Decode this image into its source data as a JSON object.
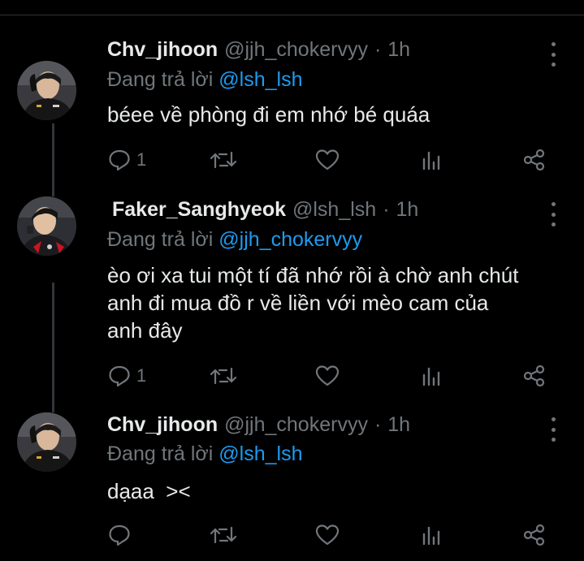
{
  "colors": {
    "background": "#000000",
    "text_primary": "#e7e9ea",
    "text_secondary": "#71767b",
    "mention": "#1d9bf0",
    "thread_line": "#333639"
  },
  "tweets": [
    {
      "display_name": "Chv_jihoon",
      "handle": "@jjh_chokervyy",
      "separator": "·",
      "time": "1h",
      "replying_prefix": "Đang trả lời",
      "replying_to": "@lsh_lsh",
      "text": "béee về phòng đi em nhớ bé quáa",
      "reply_count": "1",
      "avatar_icon": "profile-photo-jihoon"
    },
    {
      "display_name": "Faker_Sanghyeok",
      "handle": "@lsh_lsh",
      "separator": "·",
      "time": "1h",
      "replying_prefix": "Đang trả lời",
      "replying_to": "@jjh_chokervyy",
      "text_lines": [
        "èo ơi xa tui một tí đã nhớ rồi à chờ anh chút",
        "anh đi mua đồ r về liền với mèo cam của",
        "anh đây"
      ],
      "reply_count": "1",
      "avatar_icon": "profile-photo-faker"
    },
    {
      "display_name": "Chv_jihoon",
      "handle": "@jjh_chokervyy",
      "separator": "·",
      "time": "1h",
      "replying_prefix": "Đang trả lời",
      "replying_to": "@lsh_lsh",
      "text": "dạaa  ><",
      "reply_count": "",
      "avatar_icon": "profile-photo-jihoon"
    }
  ],
  "action_icons": [
    "reply-icon",
    "retweet-icon",
    "like-icon",
    "analytics-icon",
    "share-icon"
  ]
}
